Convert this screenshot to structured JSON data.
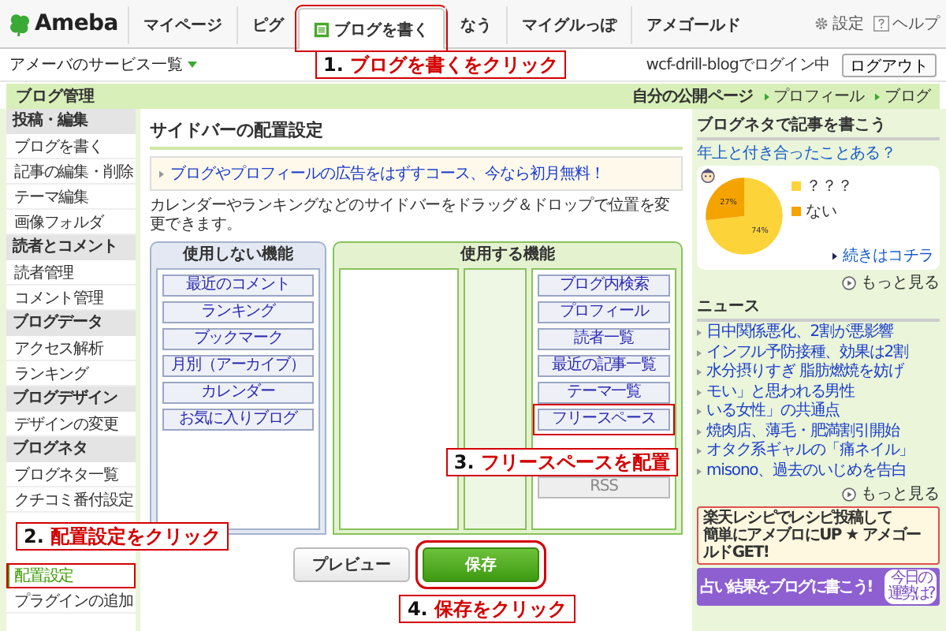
{
  "header": {
    "logo": "Ameba",
    "tabs": [
      {
        "label": "マイページ",
        "selected": false,
        "highlight": false
      },
      {
        "label": "ピグ",
        "selected": false,
        "highlight": false
      },
      {
        "label": "ブログを書く",
        "selected": true,
        "highlight": true
      },
      {
        "label": "なう",
        "selected": false,
        "highlight": false
      },
      {
        "label": "マイグルっぽ",
        "selected": false,
        "highlight": false
      },
      {
        "label": "アメゴールド",
        "selected": false,
        "highlight": false
      }
    ],
    "utilities": [
      {
        "kind": "settings",
        "label": "設定"
      },
      {
        "kind": "help",
        "label": "ヘルプ"
      }
    ],
    "callout": {
      "number": "1.",
      "text": "ブログを書くをクリック"
    }
  },
  "subbar": {
    "services": "アメーバのサービス一覧",
    "login_status": "wcf-drill-blogでログイン中",
    "logout": "ログアウト"
  },
  "banner": {
    "title": "ブログ管理",
    "links": [
      {
        "label": "自分の公開ページ",
        "kind": "page"
      },
      {
        "label": "プロフィール",
        "kind": "link"
      },
      {
        "label": "ブログ",
        "kind": "link"
      }
    ]
  },
  "sidebar": {
    "sections": [
      {
        "title": "投稿・編集",
        "children": [
          {
            "label": "ブログを書く",
            "selected": false,
            "highlight": false
          },
          {
            "label": "記事の編集・削除",
            "selected": false,
            "highlight": false
          },
          {
            "label": "テーマ編集",
            "selected": false,
            "highlight": false
          },
          {
            "label": "画像フォルダ",
            "selected": false,
            "highlight": false
          }
        ]
      },
      {
        "title": "読者とコメント",
        "children": [
          {
            "label": "読者管理",
            "selected": false,
            "highlight": false
          },
          {
            "label": "コメント管理",
            "selected": false,
            "highlight": false
          }
        ]
      },
      {
        "title": "ブログデータ",
        "children": [
          {
            "label": "アクセス解析",
            "selected": false,
            "highlight": false
          },
          {
            "label": "ランキング",
            "selected": false,
            "highlight": false
          }
        ]
      },
      {
        "title": "ブログデザイン",
        "children": [
          {
            "label": "デザインの変更",
            "selected": false,
            "highlight": false
          }
        ]
      },
      {
        "title": "ブログネタ",
        "children": [
          {
            "label": "ブログネタ一覧",
            "selected": false,
            "highlight": false
          },
          {
            "label": "クチコミ番付設定",
            "selected": false,
            "highlight": false
          }
        ]
      },
      {
        "children": [
          {
            "label": "配置設定",
            "selected": true,
            "highlight": true
          },
          {
            "label": "プラグインの追加",
            "selected": false,
            "highlight": false
          }
        ]
      }
    ],
    "callout": {
      "number": "2.",
      "text": "配置設定をクリック"
    }
  },
  "center": {
    "title": "サイドバーの配置設定",
    "notice": "ブログやプロフィールの広告をはずすコース、今なら初月無料！",
    "description": "カレンダーやランキングなどのサイドバーをドラッグ＆ドロップで位置を変更できます。",
    "unused": {
      "title": "使用しない機能",
      "items": [
        "最近のコメント",
        "ランキング",
        "ブックマーク",
        "月別（アーカイブ）",
        "カレンダー",
        "お気に入りブログ"
      ]
    },
    "used": {
      "title": "使用する機能",
      "items": [
        {
          "label": "ブログ内検索",
          "disabled": false,
          "highlight": false
        },
        {
          "label": "プロフィール",
          "disabled": false,
          "highlight": false
        },
        {
          "label": "読者一覧",
          "disabled": false,
          "highlight": false
        },
        {
          "label": "最近の記事一覧",
          "disabled": false,
          "highlight": false
        },
        {
          "label": "テーマ一覧",
          "disabled": false,
          "highlight": false
        },
        {
          "label": "フリースペース",
          "disabled": false,
          "highlight": true
        },
        {
          "label": "RSS",
          "disabled": true,
          "highlight": false
        }
      ],
      "callout": {
        "number": "3.",
        "text": "フリースペースを配置"
      }
    },
    "buttons": [
      {
        "label": "プレビュー",
        "kind": "secondary",
        "highlight": false
      },
      {
        "label": "保存",
        "kind": "primary",
        "highlight": true
      }
    ],
    "callout": {
      "number": "4.",
      "text": "保存をクリック"
    }
  },
  "right": {
    "neta": {
      "title": "ブログネタで記事を書こう",
      "question": "年上と付き合ったことある？",
      "chart_data": {
        "type": "pie",
        "categories": [
          "？？？",
          "ない"
        ],
        "values": [
          74,
          27
        ],
        "value_labels": [
          "74%",
          "27%"
        ]
      },
      "continue": "続きはコチラ",
      "more": "もっと見る"
    },
    "news": {
      "title": "ニュース",
      "items": [
        "日中関係悪化、2割が悪影響",
        "インフル予防接種、効果は2割",
        "水分摂りすぎ 脂肪燃焼を妨げ",
        "モい」と思われる男性",
        "いる女性」の共通点",
        "焼肉店、薄毛・肥満割引開始",
        "オタク系ギャルの「痛ネイル」",
        "misono、過去のいじめを告白"
      ],
      "more": "もっと見る"
    },
    "ads": [
      {
        "kind": "recipe",
        "lines": [
          "楽天レシピでレシピ投稿して",
          "簡単にアメブロにUP ★ アメゴールドGET!"
        ]
      },
      {
        "kind": "fortune",
        "text": "占い結果をブログに書こう!",
        "badge": "今日の運勢は?"
      }
    ]
  }
}
